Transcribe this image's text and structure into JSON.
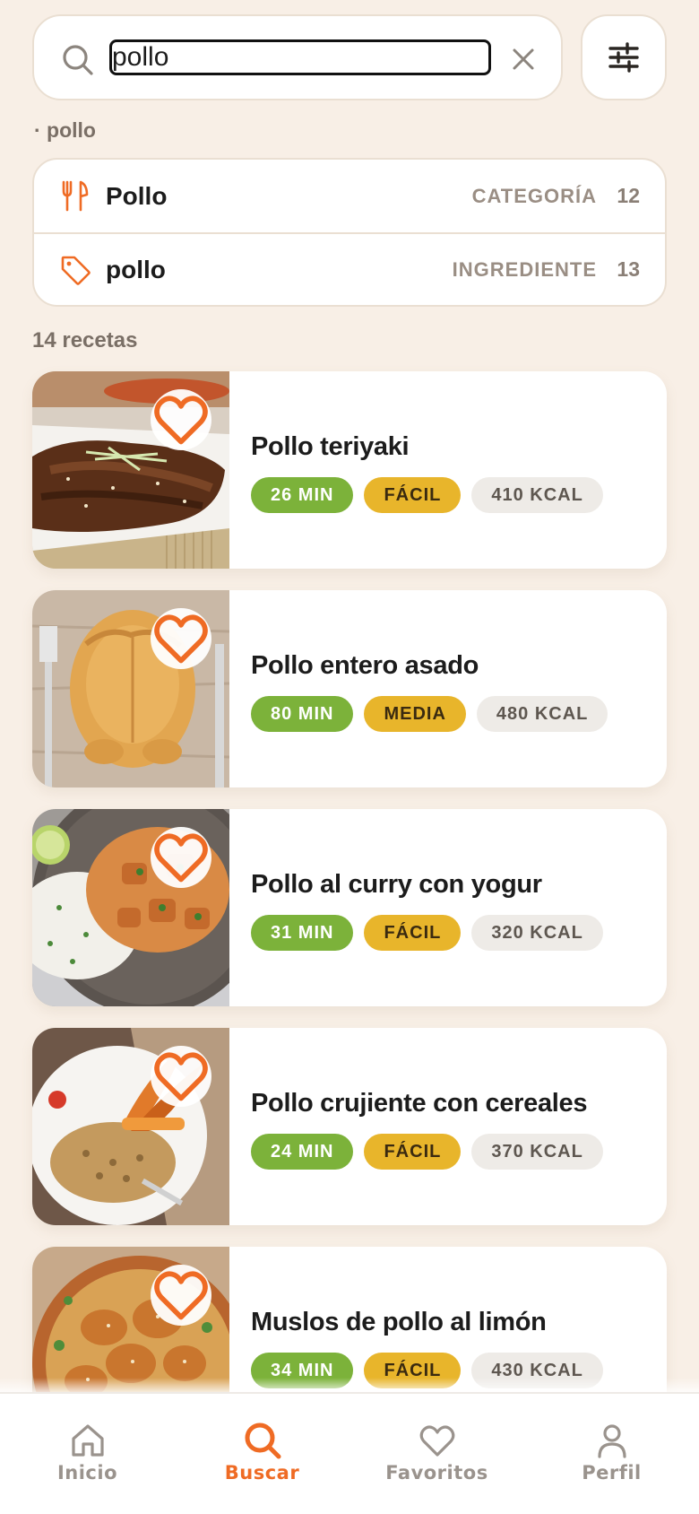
{
  "search": {
    "value": "pollo",
    "placeholder": "",
    "query_echo": "· pollo"
  },
  "suggestions": [
    {
      "name": "Pollo",
      "type": "CATEGORÍA",
      "count": "12",
      "icon": "fork-knife-icon"
    },
    {
      "name": "pollo",
      "type": "INGREDIENTE",
      "count": "13",
      "icon": "tag-icon"
    }
  ],
  "results": {
    "count_label": "14 recetas",
    "items": [
      {
        "title": "Pollo teriyaki",
        "time": "26 MIN",
        "difficulty": "FÁCIL",
        "kcal": "410 KCAL"
      },
      {
        "title": "Pollo entero asado",
        "time": "80 MIN",
        "difficulty": "MEDIA",
        "kcal": "480 KCAL"
      },
      {
        "title": "Pollo al curry con yogur",
        "time": "31 MIN",
        "difficulty": "FÁCIL",
        "kcal": "320 KCAL"
      },
      {
        "title": "Pollo crujiente con cereales",
        "time": "24 MIN",
        "difficulty": "FÁCIL",
        "kcal": "370 KCAL"
      },
      {
        "title": "Muslos de pollo al limón",
        "time": "34 MIN",
        "difficulty": "FÁCIL",
        "kcal": "430 KCAL"
      }
    ]
  },
  "nav": {
    "items": [
      {
        "label": "Inicio",
        "icon": "home-icon"
      },
      {
        "label": "Buscar",
        "icon": "search-icon"
      },
      {
        "label": "Favoritos",
        "icon": "heart-icon"
      },
      {
        "label": "Perfil",
        "icon": "user-icon"
      }
    ],
    "active": "Buscar"
  },
  "colors": {
    "accent": "#ef6b24",
    "background": "#f8efe6",
    "time_chip": "#7cb23a",
    "difficulty_chip": "#e8b52b",
    "kcal_chip": "#eeebe7"
  }
}
